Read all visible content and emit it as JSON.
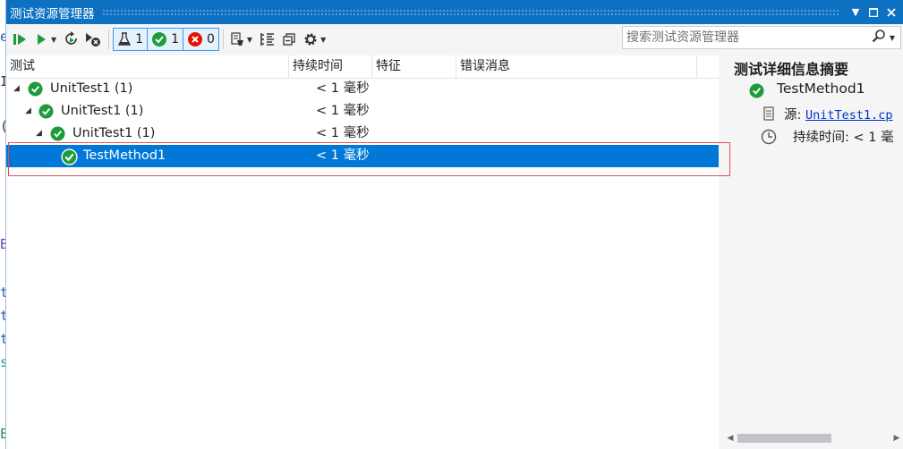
{
  "window": {
    "title": "测试资源管理器"
  },
  "toolbar": {
    "filters": {
      "total": "1",
      "passed": "1",
      "failed": "0"
    },
    "search_placeholder": "搜索测试资源管理器"
  },
  "columns": [
    "测试",
    "持续时间",
    "特征",
    "错误消息"
  ],
  "tree": [
    {
      "label": "UnitTest1  (1)",
      "duration": "< 1 毫秒",
      "level": 0
    },
    {
      "label": "UnitTest1  (1)",
      "duration": "< 1 毫秒",
      "level": 1
    },
    {
      "label": "UnitTest1  (1)",
      "duration": "< 1 毫秒",
      "level": 2
    },
    {
      "label": "TestMethod1",
      "duration": "< 1 毫秒",
      "level": 3,
      "selected": true
    }
  ],
  "detail": {
    "title": "测试详细信息摘要",
    "test_name": "TestMethod1",
    "source_label": "源:",
    "source_link": "UnitTest1.cp",
    "duration_label": "持续时间:",
    "duration_value": "< 1 毫"
  },
  "editor_glyphs": [
    "e",
    "I",
    "(",
    "B",
    "t",
    "t",
    "t",
    "s",
    "E"
  ],
  "colors": {
    "accent": "#0e70c0",
    "selection": "#0078d7",
    "pass": "#1e9b3a",
    "fail": "#e51400"
  }
}
